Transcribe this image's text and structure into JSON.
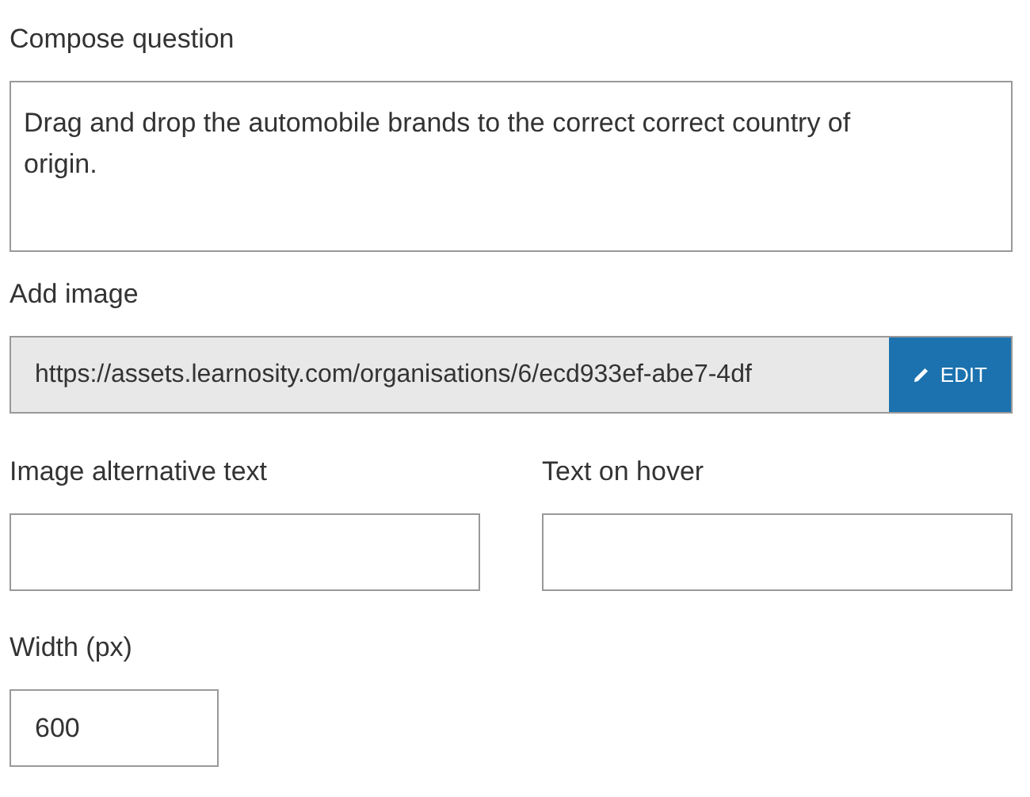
{
  "question": {
    "label": "Compose question",
    "value": "Drag and drop the automobile brands to the correct correct country of origin."
  },
  "image": {
    "label": "Add image",
    "url": "https://assets.learnosity.com/organisations/6/ecd933ef-abe7-4df",
    "button": "EDIT"
  },
  "fields": [
    {
      "label": "Image alternative text"
    },
    {
      "label": "Text on hover"
    }
  ],
  "width": {
    "label": "Width (px)",
    "value": "600"
  }
}
